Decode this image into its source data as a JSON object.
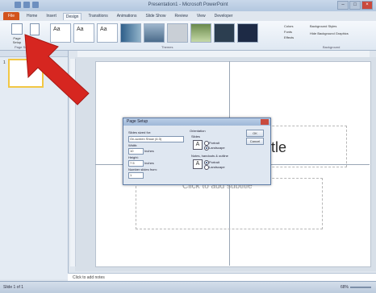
{
  "window": {
    "title": "Presentation1 - Microsoft PowerPoint",
    "controls": [
      "–",
      "□",
      "×"
    ]
  },
  "ribbon_tabs": {
    "file": "File",
    "tabs": [
      "Home",
      "Insert",
      "Design",
      "Transitions",
      "Animations",
      "Slide Show",
      "Review",
      "View",
      "Developer"
    ],
    "active": "Design"
  },
  "ribbon": {
    "page_setup": "Page Setup",
    "slide_orientation": "Slide Orientation",
    "group_page_setup": "Page Setup",
    "group_themes": "Themes",
    "group_background": "Background",
    "theme_sample": "Aa",
    "colors": "Colors",
    "fonts": "Fonts",
    "effects": "Effects",
    "background_styles": "Background Styles",
    "hide_background": "Hide Background Graphics"
  },
  "slide": {
    "number": "1",
    "title_visible": "tle",
    "subtitle": "Click to add subtitle"
  },
  "dialog": {
    "title": "Page Setup",
    "slides_sized_for_label": "Slides sized for:",
    "slides_sized_for_value": "On-screen Show (4:3)",
    "width_label": "Width:",
    "width_value": "10",
    "width_unit": "Inches",
    "height_label": "Height:",
    "height_value": "7.5",
    "height_unit": "Inches",
    "number_from_label": "Number slides from:",
    "number_from_value": "1",
    "orientation_label": "Orientation",
    "slides_label": "Slides",
    "notes_label": "Notes, handouts & outline",
    "portrait": "Portrait",
    "landscape": "Landscape",
    "ok": "OK",
    "cancel": "Cancel",
    "orientation_icon": "A"
  },
  "notes": {
    "placeholder": "Click to add notes"
  },
  "status": {
    "slide_info": "Slide 1 of 1",
    "zoom": "68%"
  },
  "colors": {
    "file_tab": "#d2541e",
    "arrow": "#d62620",
    "selected_thumb_border": "#f2c744"
  },
  "icons": [
    "page-setup-icon",
    "slide-orientation-icon",
    "red-arrow-pointer-icon",
    "close-icon",
    "orientation-icon"
  ]
}
